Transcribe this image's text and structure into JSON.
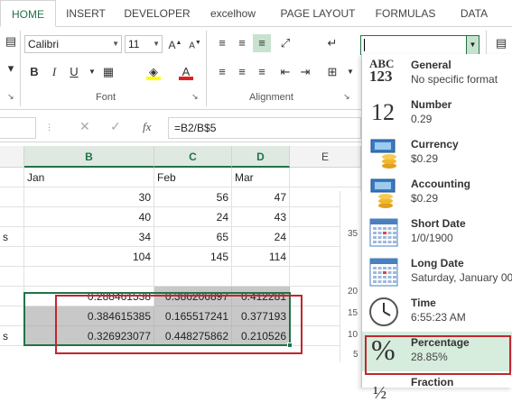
{
  "tabs": [
    "HOME",
    "INSERT",
    "DEVELOPER",
    "excelhow",
    "PAGE LAYOUT",
    "FORMULAS",
    "DATA"
  ],
  "ribbon": {
    "font_name": "Calibri",
    "font_size": "11",
    "font_group_label": "Font",
    "alignment_group_label": "Alignment",
    "number_format_value": ""
  },
  "formula_bar": {
    "fx_label": "fx",
    "formula": "=B2/B$5"
  },
  "columns": [
    "B",
    "C",
    "D",
    "E"
  ],
  "rows": [
    {
      "a": "",
      "b": "Jan",
      "c": "Feb",
      "d": "Mar"
    },
    {
      "a": "",
      "b": "30",
      "c": "56",
      "d": "47"
    },
    {
      "a": "",
      "b": "40",
      "c": "24",
      "d": "43"
    },
    {
      "a": "s",
      "b": "34",
      "c": "65",
      "d": "24"
    },
    {
      "a": "",
      "b": "104",
      "c": "145",
      "d": "114"
    },
    {
      "a": "",
      "b": "",
      "c": "",
      "d": ""
    },
    {
      "a": "",
      "b": "0.288461538",
      "c": "0.386206897",
      "d": "0.412281"
    },
    {
      "a": "",
      "b": "0.384615385",
      "c": "0.165517241",
      "d": "0.377193"
    },
    {
      "a": "s",
      "b": "0.326923077",
      "c": "0.448275862",
      "d": "0.210526"
    }
  ],
  "chart_axis_fragments": [
    "35",
    "20",
    "15",
    "10",
    "5"
  ],
  "number_formats": [
    {
      "name": "General",
      "example": "No specific format",
      "icon": "general-icon"
    },
    {
      "name": "Number",
      "example": "0.29",
      "icon": "number-icon"
    },
    {
      "name": "Currency",
      "example": "$0.29",
      "icon": "currency-icon"
    },
    {
      "name": "Accounting",
      "example": " $0.29",
      "icon": "accounting-icon"
    },
    {
      "name": "Short Date",
      "example": "1/0/1900",
      "icon": "calendar-icon"
    },
    {
      "name": "Long Date",
      "example": "Saturday, January 00,",
      "icon": "calendar-icon"
    },
    {
      "name": "Time",
      "example": "6:55:23 AM",
      "icon": "clock-icon"
    },
    {
      "name": "Percentage",
      "example": "28.85%",
      "icon": "percent-icon"
    },
    {
      "name": "Fraction",
      "example": "",
      "icon": "fraction-icon"
    }
  ],
  "icon_text": {
    "general_abc": "ABC",
    "general_123": "123",
    "number_12": "12",
    "percent": "%"
  },
  "colors": {
    "accent": "#217346",
    "highlight_border": "#c0272d",
    "selected_format_bg": "#d6ecdd"
  }
}
